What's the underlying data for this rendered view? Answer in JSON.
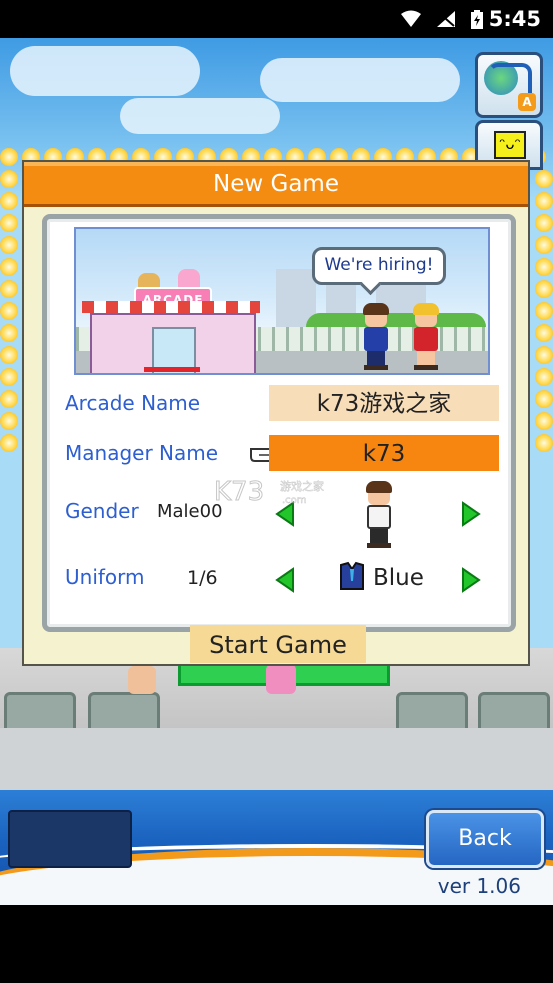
{
  "status_bar": {
    "time": "5:45"
  },
  "dialog": {
    "title": "New Game",
    "speech_bubble": "We're hiring!",
    "sign_text": "ARCADE",
    "fields": {
      "arcade_name_label": "Arcade Name",
      "arcade_name_value": "k73游戏之家",
      "manager_name_label": "Manager Name",
      "manager_name_value": "k73",
      "gender_label": "Gender",
      "gender_value": "Male00",
      "uniform_label": "Uniform",
      "uniform_index": "1/6",
      "uniform_value": "Blue"
    },
    "start_button": "Start Game"
  },
  "bottom_bar": {
    "back_button": "Back",
    "version": "ver 1.06"
  },
  "colors": {
    "header_orange": "#f58c12",
    "label_blue": "#2d5fd0",
    "arrow_green": "#22c62b"
  }
}
